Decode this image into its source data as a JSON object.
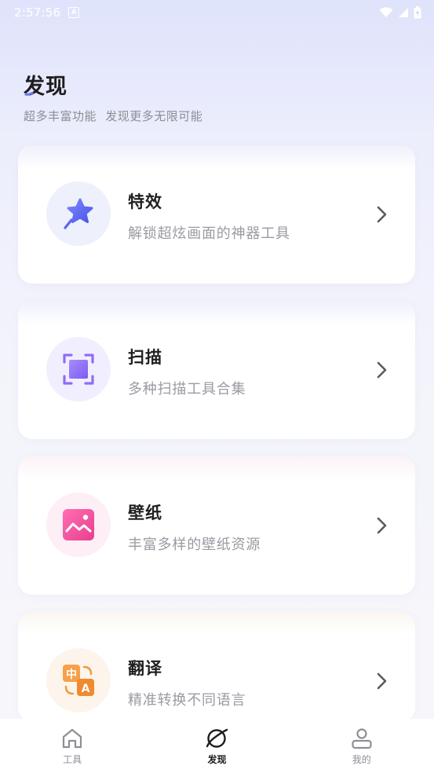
{
  "status_bar": {
    "time": "2:57:56",
    "notification_badge": "A"
  },
  "header": {
    "title": "发现",
    "subtitle": "超多丰富功能  发现更多无限可能"
  },
  "cards": [
    {
      "title": "特效",
      "description": "解锁超炫画面的神器工具",
      "icon": "magic-wand-star-icon",
      "icon_bg": "#eef0fc",
      "icon_color": "#5b67f0"
    },
    {
      "title": "扫描",
      "description": "多种扫描工具合集",
      "icon": "scan-frame-icon",
      "icon_bg": "#f1efff",
      "icon_color": "#8f6cf6"
    },
    {
      "title": "壁纸",
      "description": "丰富多样的壁纸资源",
      "icon": "wallpaper-image-icon",
      "icon_bg": "#fdeff5",
      "icon_color": "#f0479a"
    },
    {
      "title": "翻译",
      "description": "精准转换不同语言",
      "icon": "translate-icon",
      "icon_bg": "#fdf5ec",
      "icon_color": "#f29a3a"
    }
  ],
  "translate_glyphs": {
    "zh": "中",
    "a": "A"
  },
  "tab_bar": {
    "tabs": [
      {
        "label": "工具",
        "icon": "home-icon",
        "active": false
      },
      {
        "label": "发现",
        "icon": "discover-planet-icon",
        "active": true
      },
      {
        "label": "我的",
        "icon": "user-icon",
        "active": false
      }
    ]
  }
}
